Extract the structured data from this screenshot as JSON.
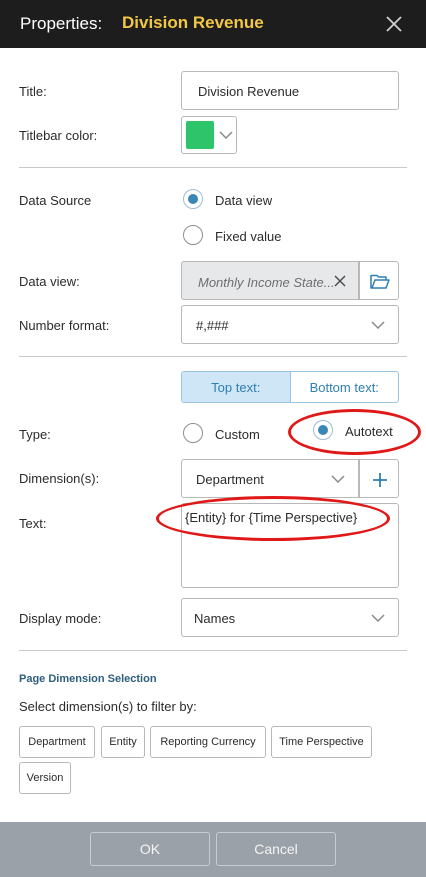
{
  "dialog": {
    "header_label": "Properties:",
    "header_name": "Division Revenue"
  },
  "general": {
    "title_label": "Title:",
    "title_value": "Division Revenue",
    "titlebar_color_label": "Titlebar color:",
    "titlebar_color": "#2ec46a"
  },
  "datasource": {
    "label": "Data Source",
    "option_dataview": "Data view",
    "option_fixed": "Fixed value",
    "selected": "Data view",
    "dataview_label": "Data view:",
    "dataview_value": "Monthly Income State...",
    "number_format_label": "Number format:",
    "number_format_value": "#,###"
  },
  "text_settings": {
    "tab_top": "Top text:",
    "tab_bottom": "Bottom text:",
    "type_label": "Type:",
    "type_custom": "Custom",
    "type_autotext": "Autotext",
    "type_selected": "Autotext",
    "dimensions_label": "Dimension(s):",
    "dimensions_value": "Department",
    "text_label": "Text:",
    "text_value": "{Entity} for {Time Perspective}",
    "display_mode_label": "Display mode:",
    "display_mode_value": "Names"
  },
  "page_dimension": {
    "title": "Page Dimension Selection",
    "subtitle": "Select dimension(s) to filter by:",
    "chips": [
      "Department",
      "Entity",
      "Reporting Currency",
      "Time Perspective",
      "Version"
    ]
  },
  "footer": {
    "ok_label": "OK",
    "cancel_label": "Cancel"
  },
  "colors": {
    "accent": "#3a86b6",
    "header_bg": "#1d1d1d",
    "header_name": "#f2c744",
    "annotation": "#e01818"
  }
}
